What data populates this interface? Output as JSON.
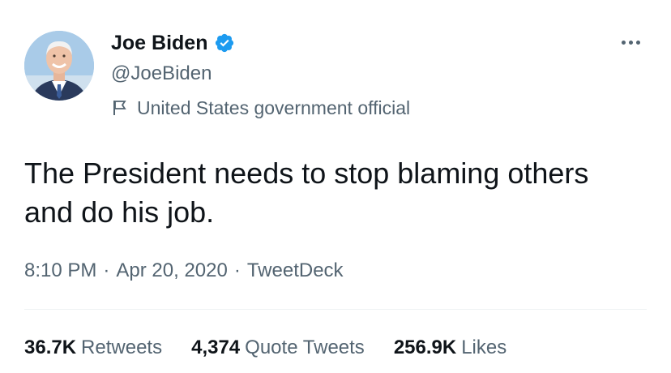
{
  "author": {
    "display_name": "Joe Biden",
    "handle": "@JoeBiden",
    "label": "United States government official",
    "verified_icon": "verified-badge-icon",
    "flag_icon": "flag-icon"
  },
  "tweet": {
    "text": "The President needs to stop blaming others and do his job.",
    "time": "8:10 PM",
    "separator": "·",
    "date": "Apr 20, 2020",
    "source": "TweetDeck"
  },
  "stats": [
    {
      "count": "36.7K",
      "label": "Retweets"
    },
    {
      "count": "4,374",
      "label": "Quote Tweets"
    },
    {
      "count": "256.9K",
      "label": "Likes"
    }
  ],
  "colors": {
    "accent": "#1d9bf0",
    "text_primary": "#0f1419",
    "text_secondary": "#536471"
  }
}
